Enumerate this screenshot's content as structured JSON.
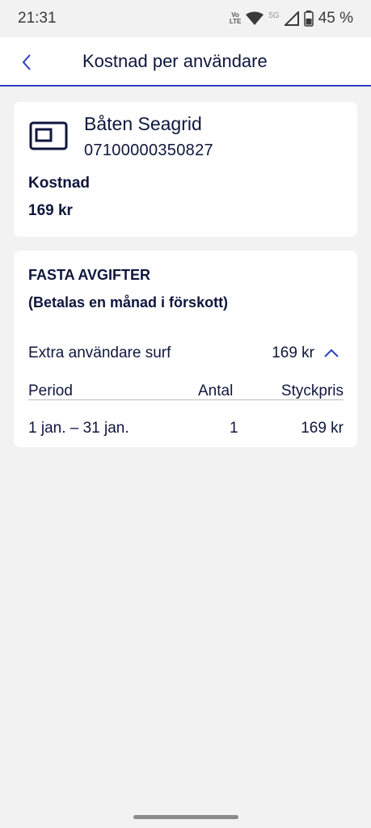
{
  "status_bar": {
    "time": "21:31",
    "volte": "Vo LTE",
    "network": "5G",
    "battery": "45 %",
    "icons": [
      "wifi-icon",
      "signal-icon",
      "battery-icon"
    ]
  },
  "app_bar": {
    "title": "Kostnad per användare",
    "back_icon": "chevron-left-icon"
  },
  "user_card": {
    "name": "Båten Seagrid",
    "number": "07100000350827",
    "cost_label": "Kostnad",
    "cost_value": "169 kr",
    "icon": "sim-card-icon"
  },
  "fees_card": {
    "title": "FASTA AVGIFTER",
    "subtitle": "(Betalas en månad i förskott)",
    "item": {
      "name": "Extra användare surf",
      "price": "169 kr",
      "expanded": true
    },
    "table": {
      "headers": {
        "period": "Period",
        "antal": "Antal",
        "styckpris": "Styckpris"
      },
      "rows": [
        {
          "period": "1 jan. – 31 jan.",
          "antal": "1",
          "styckpris": "169 kr"
        }
      ]
    }
  },
  "colors": {
    "accent": "#2b3fc0",
    "text": "#0f163d",
    "background": "#f2f2f2",
    "card": "#ffffff"
  }
}
